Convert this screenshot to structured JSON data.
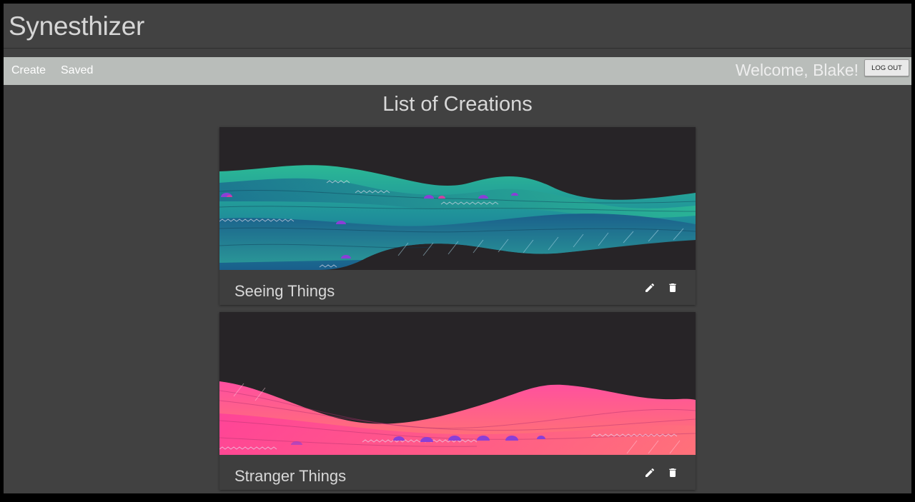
{
  "app": {
    "title": "Synesthizer"
  },
  "nav": {
    "create_label": "Create",
    "saved_label": "Saved",
    "welcome_text": "Welcome, Blake!",
    "logout_label": "LOG OUT"
  },
  "main": {
    "heading": "List of Creations",
    "creations": [
      {
        "title": "Seeing Things",
        "palette": [
          "#1d5f8c",
          "#2bb896"
        ]
      },
      {
        "title": "Stranger Things",
        "palette": [
          "#ff4fa0",
          "#ff7a6a"
        ]
      }
    ]
  },
  "icons": {
    "edit": "pencil-icon",
    "delete": "trash-icon"
  },
  "colors": {
    "background": "#414141",
    "navbar": "#b9bdba",
    "card_art_background": "#272427",
    "accent_purple": "#8a3fd6"
  }
}
